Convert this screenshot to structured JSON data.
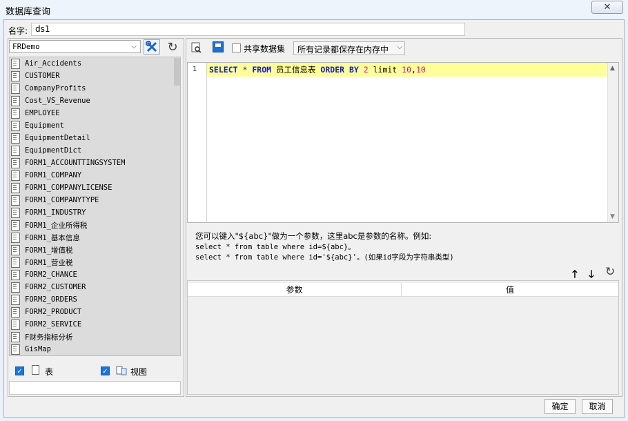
{
  "window": {
    "title": "数据库查询",
    "close_glyph": "✕"
  },
  "name_field": {
    "label": "名字:",
    "value": "ds1"
  },
  "datasource": {
    "selected": "FRDemo",
    "arrow": "⌵"
  },
  "tables": [
    "Air_Accidents",
    "CUSTOMER",
    "CompanyProfits",
    "Cost_VS_Revenue",
    "EMPLOYEE",
    "Equipment",
    "EquipmentDetail",
    "EquipmentDict",
    "FORM1_ACCOUNTTINGSYSTEM",
    "FORM1_COMPANY",
    "FORM1_COMPANYLICENSE",
    "FORM1_COMPANYTYPE",
    "FORM1_INDUSTRY",
    "FORM1_企业所得税",
    "FORM1_基本信息",
    "FORM1_增值税",
    "FORM1_营业税",
    "FORM2_CHANCE",
    "FORM2_CUSTOMER",
    "FORM2_ORDERS",
    "FORM2_PRODUCT",
    "FORM2_SERVICE",
    "F财务指标分析",
    "GisMap"
  ],
  "filters": {
    "table_label": "表",
    "view_label": "视图",
    "check_glyph": "✓"
  },
  "toolbar": {
    "share_label": "共享数据集",
    "memory_option": "所有记录都保存在内存中",
    "arrow": "⌵"
  },
  "sql": {
    "line_number": "1",
    "tokens": [
      {
        "text": "SELECT",
        "cls": "kw"
      },
      {
        "text": " ",
        "cls": ""
      },
      {
        "text": "*",
        "cls": "kwl"
      },
      {
        "text": " ",
        "cls": ""
      },
      {
        "text": "FROM",
        "cls": "kw"
      },
      {
        "text": " 员工信息表 ",
        "cls": ""
      },
      {
        "text": "ORDER BY",
        "cls": "kw"
      },
      {
        "text": " ",
        "cls": ""
      },
      {
        "text": "2",
        "cls": "num"
      },
      {
        "text": " limit ",
        "cls": ""
      },
      {
        "text": "10",
        "cls": "num"
      },
      {
        "text": ",",
        "cls": ""
      },
      {
        "text": "10",
        "cls": "num"
      }
    ]
  },
  "hint": {
    "line1": "您可以键入\"${abc}\"做为一个参数，这里abc是参数的名称。例如:",
    "line2": "select * from table where id=${abc}。",
    "line3": "select * from table where id='${abc}'。(如果id字段为字符串类型)"
  },
  "param_buttons": {
    "up": "🡑",
    "down": "🡓",
    "refresh": "↻"
  },
  "param_table": {
    "columns": [
      "参数",
      "值"
    ]
  },
  "dialog_buttons": {
    "ok": "确定",
    "cancel": "取消"
  },
  "misc": {
    "refresh_glyph": "↻"
  }
}
